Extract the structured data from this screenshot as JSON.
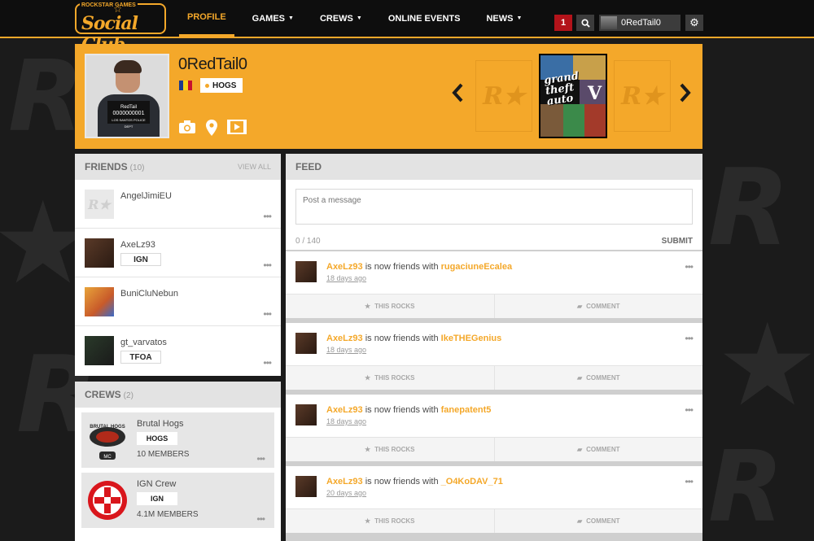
{
  "header": {
    "logo_small": "ROCKSTAR GAMES",
    "logo_big": "Social Club",
    "nav": [
      {
        "label": "PROFILE",
        "active": true,
        "dropdown": false
      },
      {
        "label": "GAMES",
        "active": false,
        "dropdown": true
      },
      {
        "label": "CREWS",
        "active": false,
        "dropdown": true
      },
      {
        "label": "ONLINE EVENTS",
        "active": false,
        "dropdown": false
      },
      {
        "label": "NEWS",
        "active": false,
        "dropdown": true
      }
    ],
    "notification_count": "1",
    "user_name": "0RedTail0",
    "icons": {
      "search": "search-icon",
      "settings": "gear-icon"
    }
  },
  "profile": {
    "username": "0RedTail0",
    "crew_tag": "HOGS",
    "avatar_board_line1": "RedTail",
    "avatar_board_line2": "0000000001",
    "avatar_board_line3": "LOS SANTOS POLICE DEPT",
    "icons": [
      "camera-icon",
      "location-icon",
      "video-icon"
    ],
    "game_cover_title_1": "grand",
    "game_cover_title_2": "theft",
    "game_cover_title_3": "auto",
    "game_cover_number": "V",
    "placeholder_mark": "R★"
  },
  "friends": {
    "title": "FRIENDS",
    "count": "(10)",
    "view_all": "VIEW ALL",
    "items": [
      {
        "name": "AngelJimiEU",
        "tag": ""
      },
      {
        "name": "AxeLz93",
        "tag": "IGN"
      },
      {
        "name": "BuniCluNebun",
        "tag": ""
      },
      {
        "name": "gt_varvatos",
        "tag": "TFOA"
      }
    ],
    "more": "•••"
  },
  "crews": {
    "title": "CREWS",
    "count": "(2)",
    "items": [
      {
        "name": "Brutal Hogs",
        "tag": "HOGS",
        "members": "10 MEMBERS",
        "emblem_text": "BRUTAL HOGS",
        "emblem_sub": "MC"
      },
      {
        "name": "IGN Crew",
        "tag": "IGN",
        "members": "4.1M MEMBERS"
      }
    ]
  },
  "feed": {
    "title": "FEED",
    "post_placeholder": "Post a message",
    "char_count": "0 / 140",
    "submit": "SUBMIT",
    "like_label": "THIS ROCKS",
    "comment_label": "COMMENT",
    "items": [
      {
        "actor": "AxeLz93",
        "action": "is now friends with",
        "target": "rugaciuneEcalea",
        "time": "18 days ago"
      },
      {
        "actor": "AxeLz93",
        "action": "is now friends with",
        "target": "IkeTHEGenius",
        "time": "18 days ago"
      },
      {
        "actor": "AxeLz93",
        "action": "is now friends with",
        "target": "fanepatent5",
        "time": "18 days ago"
      },
      {
        "actor": "AxeLz93",
        "action": "is now friends with",
        "target": "_O4KoDAV_71",
        "time": "20 days ago"
      }
    ]
  },
  "colors": {
    "accent": "#f4a82a",
    "nav_bg": "#0e0e0e",
    "alert": "#b3131a"
  }
}
